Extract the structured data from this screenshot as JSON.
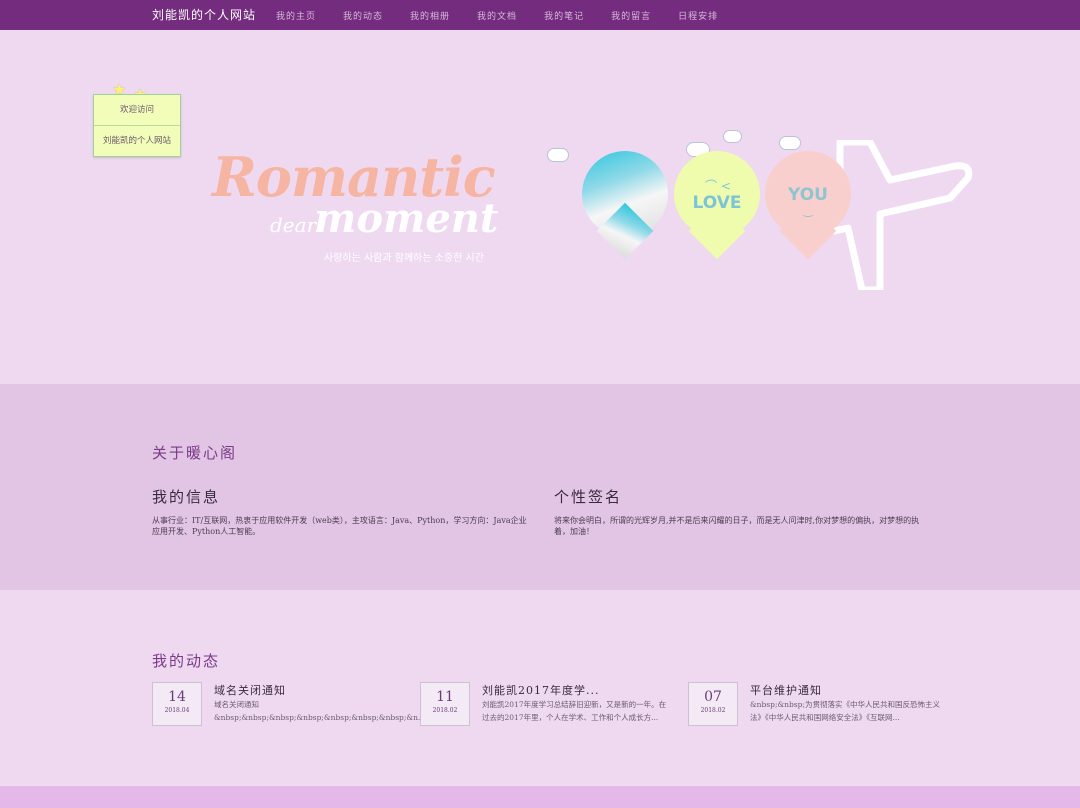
{
  "nav": {
    "brand": "刘能凯的个人网站",
    "items": [
      {
        "label": "我的主页"
      },
      {
        "label": "我的动态"
      },
      {
        "label": "我的相册"
      },
      {
        "label": "我的文档"
      },
      {
        "label": "我的笔记"
      },
      {
        "label": "我的留言"
      },
      {
        "label": "日程安排"
      }
    ]
  },
  "hero": {
    "welcome_line1": "欢迎访问",
    "welcome_line2": "刘能凯的个人网站",
    "logo_word1": "Romantic",
    "logo_word2": "dear.",
    "logo_word3": "moment",
    "logo_sub": "사랑하는 사람과 함께하는 소중한 시간",
    "balloon_love": "LOVE",
    "balloon_you": "YOU"
  },
  "about": {
    "heading": "关于暖心阁",
    "info_title": "我的信息",
    "info_text": "从事行业：IT/互联网，热衷于应用软件开发（web类），主攻语言：Java、Python，学习方向：Java企业应用开发、Python人工智能。",
    "sign_title": "个性签名",
    "sign_text": "将来你会明白，所谓的光辉岁月,并不是后来闪耀的日子，而是无人问津时,你对梦想的偏执，对梦想的执着，加油！"
  },
  "news": {
    "heading": "我的动态",
    "items": [
      {
        "day": "14",
        "ym": "2018.04",
        "title": "域名关闭通知",
        "desc": "域名关闭通知 &nbsp;&nbsp;&nbsp;&nbsp;&nbsp;&nbsp;&nbsp;&n..."
      },
      {
        "day": "11",
        "ym": "2018.02",
        "title": "刘能凯2017年度学...",
        "desc": "刘能凯2017年度学习总结辞旧迎新，又是新的一年。在过去的2017年里，个人在学术、工作和个人成长方..."
      },
      {
        "day": "07",
        "ym": "2018.02",
        "title": "平台维护通知",
        "desc": "&nbsp;&nbsp;为贯彻落实《中华人民共和国反恐怖主义法》《中华人民共和国网络安全法》《互联网..."
      }
    ]
  },
  "colors": {
    "nav_bg": "#742c7e",
    "page_bg": "#eed9f1",
    "about_bg": "#e2c5e4",
    "heading": "#7a3a88"
  }
}
